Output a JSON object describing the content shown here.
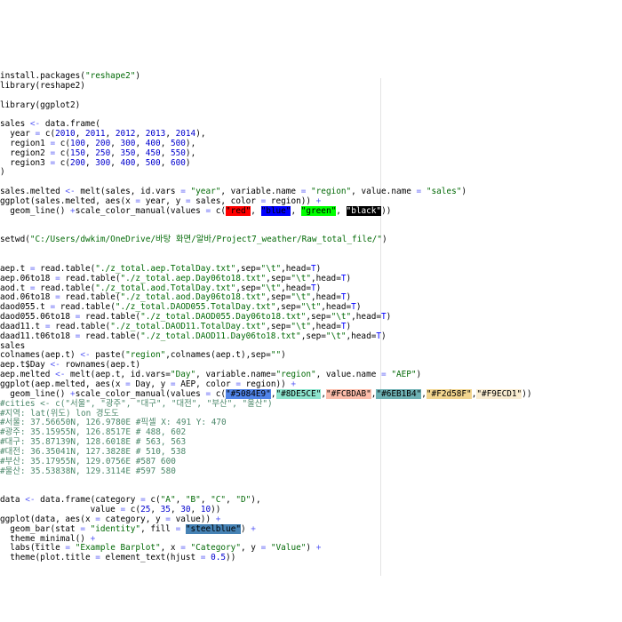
{
  "editor": {
    "colors": {
      "background": "#ffffff",
      "text": "#000000",
      "string": "#036a07",
      "number": "#0000cd",
      "operator": "#585cf6",
      "keyword": "#0000ff",
      "comment": "#4c886b",
      "margin_line": "#e3e3e3"
    },
    "lines": [
      [
        {
          "t": "install.packages("
        },
        {
          "t": "\"reshape2\"",
          "c": "str"
        },
        {
          "t": ")"
        }
      ],
      [
        {
          "t": "library(reshape2)"
        }
      ],
      [
        {
          "t": ""
        }
      ],
      [
        {
          "t": "library(ggplot2)"
        }
      ],
      [
        {
          "t": ""
        }
      ],
      [
        {
          "t": "sales "
        },
        {
          "t": "<-",
          "c": "op"
        },
        {
          "t": " data.frame("
        }
      ],
      [
        {
          "t": "  year "
        },
        {
          "t": "=",
          "c": "op"
        },
        {
          "t": " c("
        },
        {
          "t": "2010",
          "c": "num"
        },
        {
          "t": ", "
        },
        {
          "t": "2011",
          "c": "num"
        },
        {
          "t": ", "
        },
        {
          "t": "2012",
          "c": "num"
        },
        {
          "t": ", "
        },
        {
          "t": "2013",
          "c": "num"
        },
        {
          "t": ", "
        },
        {
          "t": "2014",
          "c": "num"
        },
        {
          "t": "),"
        }
      ],
      [
        {
          "t": "  region1 "
        },
        {
          "t": "=",
          "c": "op"
        },
        {
          "t": " c("
        },
        {
          "t": "100",
          "c": "num"
        },
        {
          "t": ", "
        },
        {
          "t": "200",
          "c": "num"
        },
        {
          "t": ", "
        },
        {
          "t": "300",
          "c": "num"
        },
        {
          "t": ", "
        },
        {
          "t": "400",
          "c": "num"
        },
        {
          "t": ", "
        },
        {
          "t": "500",
          "c": "num"
        },
        {
          "t": "),"
        }
      ],
      [
        {
          "t": "  region2 "
        },
        {
          "t": "=",
          "c": "op"
        },
        {
          "t": " c("
        },
        {
          "t": "150",
          "c": "num"
        },
        {
          "t": ", "
        },
        {
          "t": "250",
          "c": "num"
        },
        {
          "t": ", "
        },
        {
          "t": "350",
          "c": "num"
        },
        {
          "t": ", "
        },
        {
          "t": "450",
          "c": "num"
        },
        {
          "t": ", "
        },
        {
          "t": "550",
          "c": "num"
        },
        {
          "t": "),"
        }
      ],
      [
        {
          "t": "  region3 "
        },
        {
          "t": "=",
          "c": "op"
        },
        {
          "t": " c("
        },
        {
          "t": "200",
          "c": "num"
        },
        {
          "t": ", "
        },
        {
          "t": "300",
          "c": "num"
        },
        {
          "t": ", "
        },
        {
          "t": "400",
          "c": "num"
        },
        {
          "t": ", "
        },
        {
          "t": "500",
          "c": "num"
        },
        {
          "t": ", "
        },
        {
          "t": "600",
          "c": "num"
        },
        {
          "t": ")"
        }
      ],
      [
        {
          "t": ")"
        }
      ],
      [
        {
          "t": ""
        }
      ],
      [
        {
          "t": "sales.melted "
        },
        {
          "t": "<-",
          "c": "op"
        },
        {
          "t": " melt(sales, id.vars "
        },
        {
          "t": "=",
          "c": "op"
        },
        {
          "t": " "
        },
        {
          "t": "\"year\"",
          "c": "str"
        },
        {
          "t": ", variable.name "
        },
        {
          "t": "=",
          "c": "op"
        },
        {
          "t": " "
        },
        {
          "t": "\"region\"",
          "c": "str"
        },
        {
          "t": ", value.name "
        },
        {
          "t": "=",
          "c": "op"
        },
        {
          "t": " "
        },
        {
          "t": "\"sales\"",
          "c": "str"
        },
        {
          "t": ")"
        }
      ],
      [
        {
          "t": "ggplot(sales.melted, aes(x "
        },
        {
          "t": "=",
          "c": "op"
        },
        {
          "t": " year, y "
        },
        {
          "t": "=",
          "c": "op"
        },
        {
          "t": " sales, color "
        },
        {
          "t": "=",
          "c": "op"
        },
        {
          "t": " region)) "
        },
        {
          "t": "+",
          "c": "op"
        }
      ],
      [
        {
          "t": "  geom_line() "
        },
        {
          "t": "+",
          "c": "op"
        },
        {
          "t": "scale_color_manual(values "
        },
        {
          "t": "=",
          "c": "op"
        },
        {
          "t": " c("
        },
        {
          "t": "\"red\"",
          "c": "hl",
          "bg": "#ff0000"
        },
        {
          "t": ", "
        },
        {
          "t": "\"blue\"",
          "c": "hl",
          "bg": "#0000ff"
        },
        {
          "t": ", "
        },
        {
          "t": "\"green\"",
          "c": "hl",
          "bg": "#00ff00"
        },
        {
          "t": ", "
        },
        {
          "t": "\"black\"",
          "c": "hl",
          "bg": "#000000",
          "fg": "#ffffff"
        },
        {
          "t": "))"
        }
      ],
      [
        {
          "t": ""
        }
      ],
      [
        {
          "t": ""
        }
      ],
      [
        {
          "t": "setwd("
        },
        {
          "t": "\"C:/Users/dwkim/OneDrive/바탕 화면/알바/Project7_weather/Raw_total_file/\"",
          "c": "str"
        },
        {
          "t": ")"
        }
      ],
      [
        {
          "t": ""
        }
      ],
      [
        {
          "t": ""
        }
      ],
      [
        {
          "t": "aep.t "
        },
        {
          "t": "=",
          "c": "op"
        },
        {
          "t": " read.table("
        },
        {
          "t": "\"./z_total.aep.TotalDay.txt\"",
          "c": "str"
        },
        {
          "t": ",sep="
        },
        {
          "t": "\"\\t\"",
          "c": "str"
        },
        {
          "t": ",head="
        },
        {
          "t": "T",
          "c": "kw"
        },
        {
          "t": ")"
        }
      ],
      [
        {
          "t": "aep.06to18 "
        },
        {
          "t": "=",
          "c": "op"
        },
        {
          "t": " read.table("
        },
        {
          "t": "\"./z_total.aep.Day06to18.txt\"",
          "c": "str"
        },
        {
          "t": ",sep="
        },
        {
          "t": "\"\\t\"",
          "c": "str"
        },
        {
          "t": ",head="
        },
        {
          "t": "T",
          "c": "kw"
        },
        {
          "t": ")"
        }
      ],
      [
        {
          "t": "aod.t "
        },
        {
          "t": "=",
          "c": "op"
        },
        {
          "t": " read.table("
        },
        {
          "t": "\"./z_total.aod.TotalDay.txt\"",
          "c": "str"
        },
        {
          "t": ",sep="
        },
        {
          "t": "\"\\t\"",
          "c": "str"
        },
        {
          "t": ",head="
        },
        {
          "t": "T",
          "c": "kw"
        },
        {
          "t": ")"
        }
      ],
      [
        {
          "t": "aod.06to18 "
        },
        {
          "t": "=",
          "c": "op"
        },
        {
          "t": " read.table("
        },
        {
          "t": "\"./z_total.aod.Day06to18.txt\"",
          "c": "str"
        },
        {
          "t": ",sep="
        },
        {
          "t": "\"\\t\"",
          "c": "str"
        },
        {
          "t": ",head="
        },
        {
          "t": "T",
          "c": "kw"
        },
        {
          "t": ")"
        }
      ],
      [
        {
          "t": "daod055.t "
        },
        {
          "t": "=",
          "c": "op"
        },
        {
          "t": " read.table("
        },
        {
          "t": "\"./z_total.DAOD055.TotalDay.txt\"",
          "c": "str"
        },
        {
          "t": ",sep="
        },
        {
          "t": "\"\\t\"",
          "c": "str"
        },
        {
          "t": ",head="
        },
        {
          "t": "T",
          "c": "kw"
        },
        {
          "t": ")"
        }
      ],
      [
        {
          "t": "daod055.06to18 "
        },
        {
          "t": "=",
          "c": "op"
        },
        {
          "t": " read.table("
        },
        {
          "t": "\"./z_total.DAOD055.Day06to18.txt\"",
          "c": "str"
        },
        {
          "t": ",sep="
        },
        {
          "t": "\"\\t\"",
          "c": "str"
        },
        {
          "t": ",head="
        },
        {
          "t": "T",
          "c": "kw"
        },
        {
          "t": ")"
        }
      ],
      [
        {
          "t": "daad11.t "
        },
        {
          "t": "=",
          "c": "op"
        },
        {
          "t": " read.table("
        },
        {
          "t": "\"./z_total.DAOD11.TotalDay.txt\"",
          "c": "str"
        },
        {
          "t": ",sep="
        },
        {
          "t": "\"\\t\"",
          "c": "str"
        },
        {
          "t": ",head="
        },
        {
          "t": "T",
          "c": "kw"
        },
        {
          "t": ")"
        }
      ],
      [
        {
          "t": "daad11.t06to18 "
        },
        {
          "t": "=",
          "c": "op"
        },
        {
          "t": " read.table("
        },
        {
          "t": "\"./z_total.DAOD11.Day06to18.txt\"",
          "c": "str"
        },
        {
          "t": ",sep="
        },
        {
          "t": "\"\\t\"",
          "c": "str"
        },
        {
          "t": ",head="
        },
        {
          "t": "T",
          "c": "kw"
        },
        {
          "t": ")"
        }
      ],
      [
        {
          "t": "sales"
        }
      ],
      [
        {
          "t": "colnames(aep.t) "
        },
        {
          "t": "<-",
          "c": "op"
        },
        {
          "t": " paste("
        },
        {
          "t": "\"region\"",
          "c": "str"
        },
        {
          "t": ",colnames(aep.t),sep="
        },
        {
          "t": "\"\"",
          "c": "str"
        },
        {
          "t": ")"
        }
      ],
      [
        {
          "t": "aep.t$Day "
        },
        {
          "t": "<-",
          "c": "op"
        },
        {
          "t": " rownames(aep.t)"
        }
      ],
      [
        {
          "t": "aep.melted "
        },
        {
          "t": "<-",
          "c": "op"
        },
        {
          "t": " melt(aep.t, id.vars="
        },
        {
          "t": "\"Day\"",
          "c": "str"
        },
        {
          "t": ", variable.name="
        },
        {
          "t": "\"region\"",
          "c": "str"
        },
        {
          "t": ", value.name "
        },
        {
          "t": "=",
          "c": "op"
        },
        {
          "t": " "
        },
        {
          "t": "\"AEP\"",
          "c": "str"
        },
        {
          "t": ")"
        }
      ],
      [
        {
          "t": "ggplot(aep.melted, aes(x "
        },
        {
          "t": "=",
          "c": "op"
        },
        {
          "t": " Day, y "
        },
        {
          "t": "=",
          "c": "op"
        },
        {
          "t": " AEP, color "
        },
        {
          "t": "=",
          "c": "op"
        },
        {
          "t": " region)) "
        },
        {
          "t": "+",
          "c": "op"
        }
      ],
      [
        {
          "t": "  geom_line() "
        },
        {
          "t": "+",
          "c": "op"
        },
        {
          "t": "scale_color_manual(values "
        },
        {
          "t": "=",
          "c": "op"
        },
        {
          "t": " c("
        },
        {
          "t": "\"#5084E9\"",
          "c": "hl",
          "bg": "#5084e9"
        },
        {
          "t": ","
        },
        {
          "t": "\"#8DE5CE\"",
          "c": "hl",
          "bg": "#8de5ce"
        },
        {
          "t": ","
        },
        {
          "t": "\"#FCBDAB\"",
          "c": "hl",
          "bg": "#fcbdab"
        },
        {
          "t": ","
        },
        {
          "t": "\"#6EB1B4\"",
          "c": "hl",
          "bg": "#6eb1b4"
        },
        {
          "t": ","
        },
        {
          "t": "\"#F2d58F\"",
          "c": "hl",
          "bg": "#f2d58f"
        },
        {
          "t": ","
        },
        {
          "t": "\"#F9ECD1\"",
          "c": "hl",
          "bg": "#f9ecd1"
        },
        {
          "t": "))"
        }
      ],
      [
        {
          "t": "#cities <- c(\"서울\", \"광주\", \"대구\", \"대전\", \"부산\", \"울산\")",
          "c": "cmt"
        }
      ],
      [
        {
          "t": "#지역: lat(위도) lon 경도도",
          "c": "cmt"
        }
      ],
      [
        {
          "t": "#서울: 37.56650N, 126.9780E #픽셀 X: 491 Y: 470",
          "c": "cmt"
        }
      ],
      [
        {
          "t": "#광주: 35.15955N, 126.8517E # 488, 602",
          "c": "cmt"
        }
      ],
      [
        {
          "t": "#대구: 35.87139N, 128.6018E # 563, 563",
          "c": "cmt"
        }
      ],
      [
        {
          "t": "#대전: 36.35041N, 127.3828E # 510, 538",
          "c": "cmt"
        }
      ],
      [
        {
          "t": "#부산: 35.17955N, 129.0756E #587 600",
          "c": "cmt"
        }
      ],
      [
        {
          "t": "#울산: 35.53838N, 129.3114E #597 580",
          "c": "cmt"
        }
      ],
      [
        {
          "t": ""
        }
      ],
      [
        {
          "t": ""
        }
      ],
      [
        {
          "t": "data "
        },
        {
          "t": "<-",
          "c": "op"
        },
        {
          "t": " data.frame(category "
        },
        {
          "t": "=",
          "c": "op"
        },
        {
          "t": " c("
        },
        {
          "t": "\"A\"",
          "c": "str"
        },
        {
          "t": ", "
        },
        {
          "t": "\"B\"",
          "c": "str"
        },
        {
          "t": ", "
        },
        {
          "t": "\"C\"",
          "c": "str"
        },
        {
          "t": ", "
        },
        {
          "t": "\"D\"",
          "c": "str"
        },
        {
          "t": "),"
        }
      ],
      [
        {
          "t": "                  value "
        },
        {
          "t": "=",
          "c": "op"
        },
        {
          "t": " c("
        },
        {
          "t": "25",
          "c": "num"
        },
        {
          "t": ", "
        },
        {
          "t": "35",
          "c": "num"
        },
        {
          "t": ", "
        },
        {
          "t": "30",
          "c": "num"
        },
        {
          "t": ", "
        },
        {
          "t": "10",
          "c": "num"
        },
        {
          "t": "))"
        }
      ],
      [
        {
          "t": "ggplot(data, aes(x "
        },
        {
          "t": "=",
          "c": "op"
        },
        {
          "t": " category, y "
        },
        {
          "t": "=",
          "c": "op"
        },
        {
          "t": " value)) "
        },
        {
          "t": "+",
          "c": "op"
        }
      ],
      [
        {
          "t": "  geom_bar(stat "
        },
        {
          "t": "=",
          "c": "op"
        },
        {
          "t": " "
        },
        {
          "t": "\"identity\"",
          "c": "str"
        },
        {
          "t": ", fill "
        },
        {
          "t": "=",
          "c": "op"
        },
        {
          "t": " "
        },
        {
          "t": "\"steelblue\"",
          "c": "hl",
          "bg": "#4682b4"
        },
        {
          "t": ") "
        },
        {
          "t": "+",
          "c": "op"
        }
      ],
      [
        {
          "t": "  theme_minimal() "
        },
        {
          "t": "+",
          "c": "op"
        }
      ],
      [
        {
          "t": "  labs(title "
        },
        {
          "t": "=",
          "c": "op"
        },
        {
          "t": " "
        },
        {
          "t": "\"Example Barplot\"",
          "c": "str"
        },
        {
          "t": ", x "
        },
        {
          "t": "=",
          "c": "op"
        },
        {
          "t": " "
        },
        {
          "t": "\"Category\"",
          "c": "str"
        },
        {
          "t": ", y "
        },
        {
          "t": "=",
          "c": "op"
        },
        {
          "t": " "
        },
        {
          "t": "\"Value\"",
          "c": "str"
        },
        {
          "t": ") "
        },
        {
          "t": "+",
          "c": "op"
        }
      ],
      [
        {
          "t": "  theme(plot.title "
        },
        {
          "t": "=",
          "c": "op"
        },
        {
          "t": " element_text(hjust "
        },
        {
          "t": "=",
          "c": "op"
        },
        {
          "t": " "
        },
        {
          "t": "0.5",
          "c": "num"
        },
        {
          "t": "))"
        }
      ]
    ]
  }
}
